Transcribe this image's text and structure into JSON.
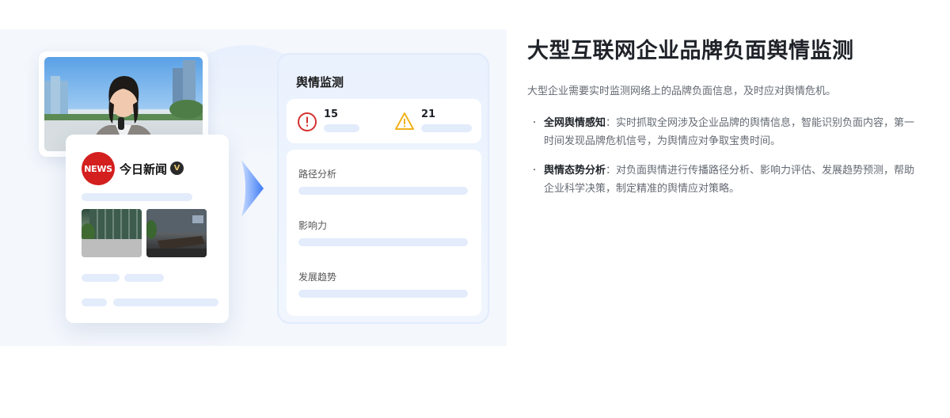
{
  "illustration": {
    "news_badge": "NEWS",
    "news_title": "今日新闻",
    "verified_badge": "V",
    "monitor": {
      "title": "舆情监测",
      "stats": [
        {
          "icon": "alert-circle-icon",
          "value": "15",
          "color": "#d43030"
        },
        {
          "icon": "warning-triangle-icon",
          "value": "21",
          "color": "#f2b21c"
        }
      ],
      "metrics": [
        "路径分析",
        "影响力",
        "发展趋势"
      ]
    }
  },
  "content": {
    "headline": "大型互联网企业品牌负面舆情监测",
    "description": "大型企业需要实时监测网络上的品牌负面信息，及时应对舆情危机。",
    "bullets": [
      {
        "title": "全网舆情感知",
        "separator": "：",
        "line1": "实时抓取全网涉及企业品牌的舆情信息，智能识别负面内容，第一",
        "line2": "时间发现品牌危机信号，为舆情应对争取宝贵时间。"
      },
      {
        "title": "舆情态势分析",
        "separator": "：",
        "line1": "对负面舆情进行传播路径分析、影响力评估、发展趋势预测，帮助",
        "line2": "企业科学决策，制定精准的舆情应对策略。"
      }
    ]
  },
  "colors": {
    "accent": "#3d7bf5",
    "bar": "#e3ecfb",
    "news_red": "#d41f1f"
  }
}
